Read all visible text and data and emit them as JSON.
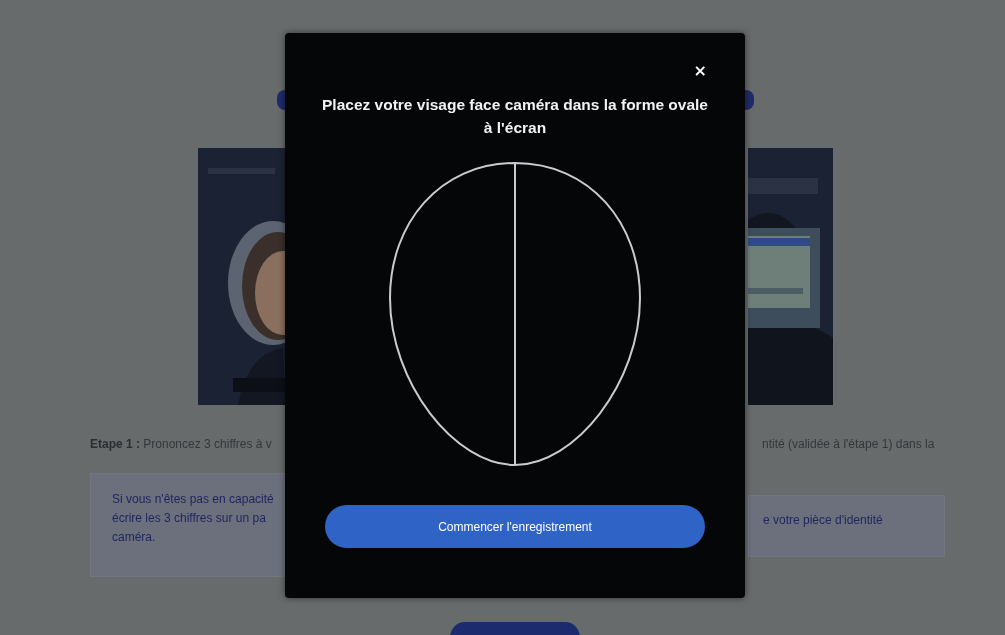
{
  "background_page": {
    "left_column": {
      "step_text": "**Etape 1 :** Prononcez 3 chiffres à v",
      "notice_lines": [
        "Si vous n'êtes pas en capacité",
        "écrire les 3 chiffres sur un pa",
        "caméra."
      ]
    },
    "right_column": {
      "step_text": "ntité (validée à l'étape 1) dans la",
      "notice_lines": [
        "e votre pièce d'identité"
      ]
    }
  },
  "modal": {
    "close": "×",
    "title": "Placez votre visage face caméra dans la forme ovale à l'écran",
    "start_button": "Commencer l'enregistrement"
  }
}
